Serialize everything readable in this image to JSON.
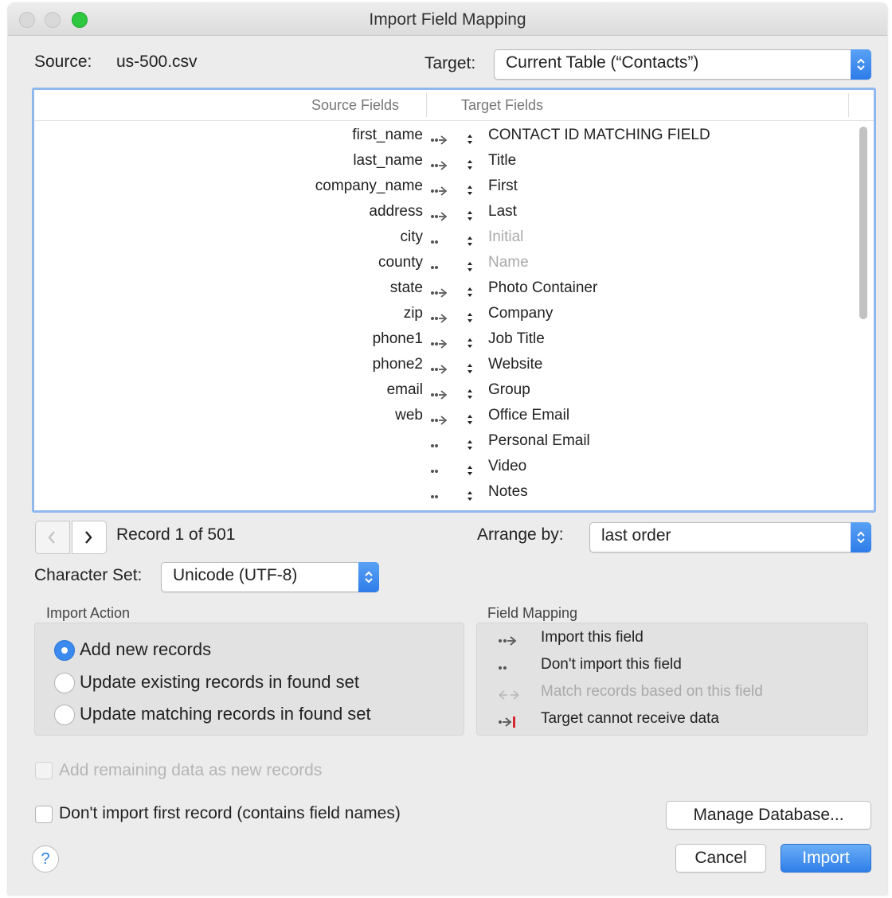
{
  "window": {
    "title": "Import Field Mapping"
  },
  "source": {
    "label": "Source:",
    "value": "us-500.csv"
  },
  "target": {
    "label": "Target:",
    "value": "Current Table (“Contacts”)"
  },
  "table": {
    "headers": {
      "source": "Source Fields",
      "target": "Target Fields"
    },
    "rows": [
      {
        "source": "first_name",
        "arrow": "import",
        "target": "CONTACT ID MATCHING FIELD",
        "dim": false
      },
      {
        "source": "last_name",
        "arrow": "import",
        "target": "Title",
        "dim": false
      },
      {
        "source": "company_name",
        "arrow": "import",
        "target": "First",
        "dim": false
      },
      {
        "source": "address",
        "arrow": "import",
        "target": "Last",
        "dim": false
      },
      {
        "source": "city",
        "arrow": "skip",
        "target": "Initial",
        "dim": true
      },
      {
        "source": "county",
        "arrow": "skip",
        "target": "Name",
        "dim": true
      },
      {
        "source": "state",
        "arrow": "import",
        "target": "Photo Container",
        "dim": false
      },
      {
        "source": "zip",
        "arrow": "import",
        "target": "Company",
        "dim": false
      },
      {
        "source": "phone1",
        "arrow": "import",
        "target": "Job Title",
        "dim": false
      },
      {
        "source": "phone2",
        "arrow": "import",
        "target": "Website",
        "dim": false
      },
      {
        "source": "email",
        "arrow": "import",
        "target": "Group",
        "dim": false
      },
      {
        "source": "web",
        "arrow": "import",
        "target": "Office Email",
        "dim": false
      },
      {
        "source": "",
        "arrow": "skip",
        "target": "Personal Email",
        "dim": false
      },
      {
        "source": "",
        "arrow": "skip",
        "target": "Video",
        "dim": false
      },
      {
        "source": "",
        "arrow": "skip",
        "target": "Notes",
        "dim": false
      }
    ]
  },
  "record": {
    "text": "Record 1 of 501"
  },
  "arrange": {
    "label": "Arrange by:",
    "value": "last order"
  },
  "charset": {
    "label": "Character Set:",
    "value": "Unicode (UTF-8)"
  },
  "import_action": {
    "title": "Import Action",
    "options": [
      "Add new records",
      "Update existing records in found set",
      "Update matching records in found set"
    ],
    "selected": 0
  },
  "field_mapping": {
    "title": "Field Mapping",
    "items": [
      "Import this field",
      "Don't import this field",
      "Match records based on this field",
      "Target cannot receive data"
    ]
  },
  "checkboxes": {
    "add_remaining": "Add remaining data as new records",
    "dont_import_first": "Don't import first record (contains field names)"
  },
  "buttons": {
    "manage": "Manage Database...",
    "cancel": "Cancel",
    "import": "Import",
    "help": "?"
  },
  "colors": {
    "accent": "#2f7fe9",
    "close_green": "#2ec840"
  }
}
